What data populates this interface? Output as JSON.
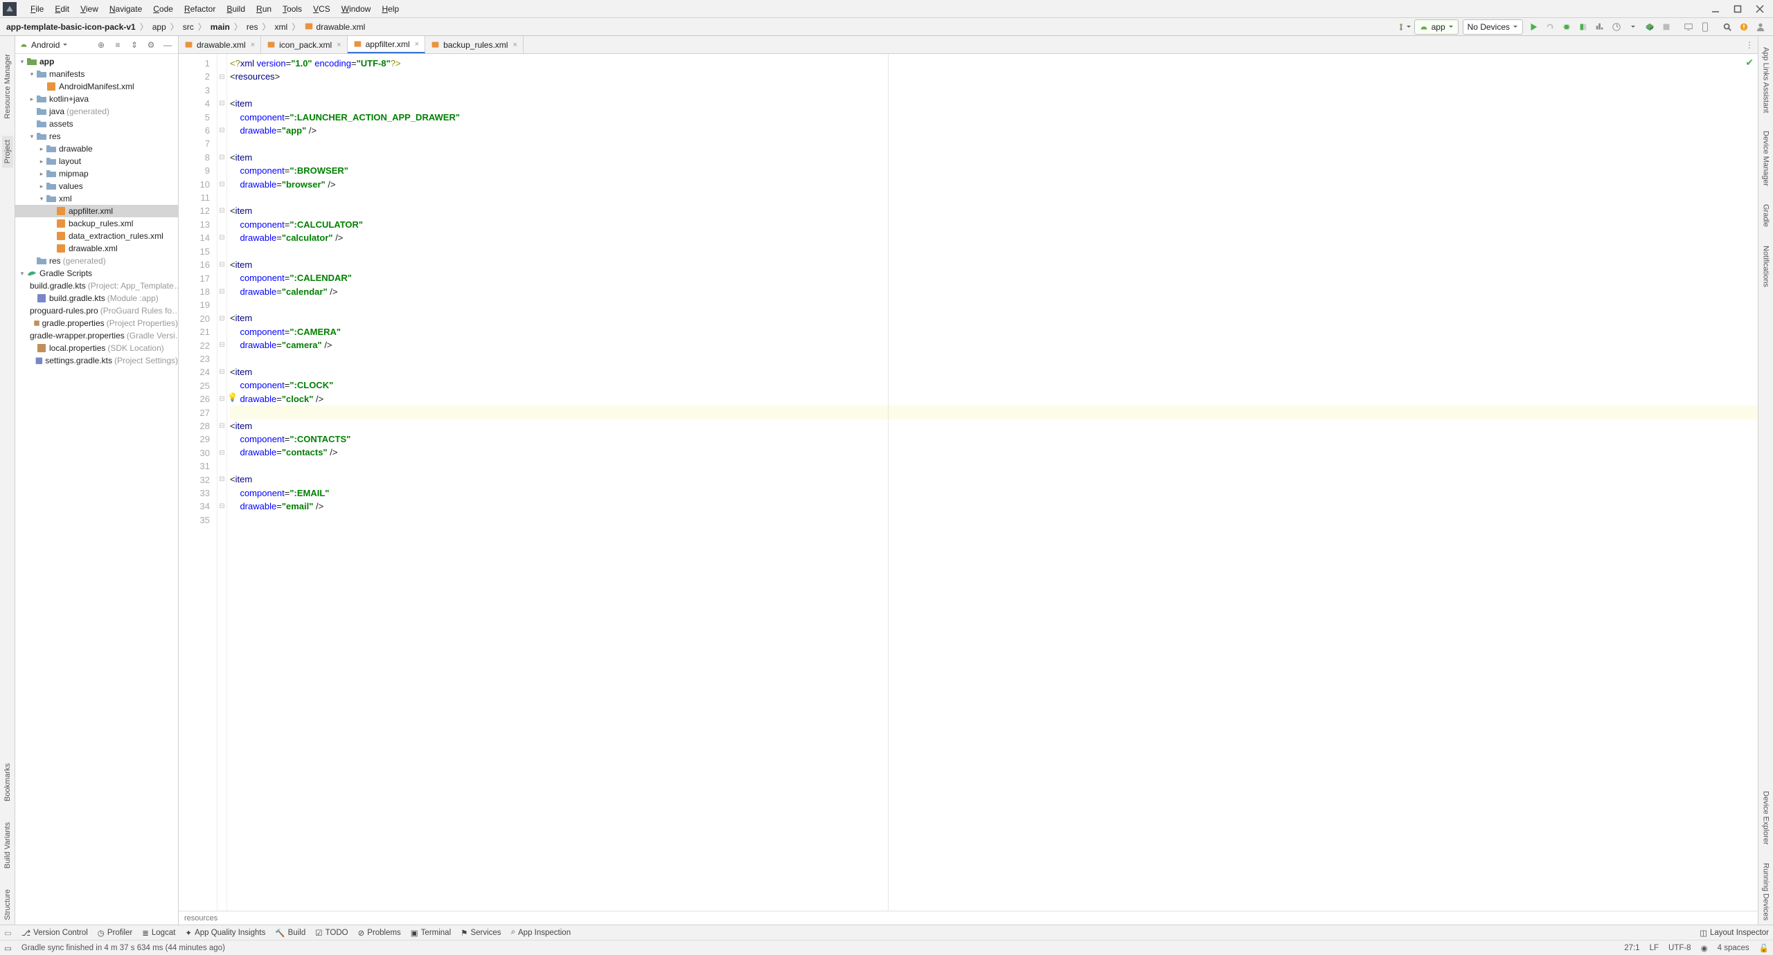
{
  "menu": {
    "items": [
      "File",
      "Edit",
      "View",
      "Navigate",
      "Code",
      "Refactor",
      "Build",
      "Run",
      "Tools",
      "VCS",
      "Window",
      "Help"
    ]
  },
  "breadcrumbs": {
    "items": [
      "app-template-basic-icon-pack-v1",
      "app",
      "src",
      "main",
      "res",
      "xml",
      "drawable.xml"
    ],
    "bold_indices": [
      0,
      3
    ]
  },
  "run_config": {
    "app_label": "app",
    "devices_label": "No Devices"
  },
  "project_header": {
    "mode": "Android"
  },
  "tree": {
    "app": "app",
    "manifests": "manifests",
    "android_manifest": "AndroidManifest.xml",
    "kotlin_java": "kotlin+java",
    "java_gen": "java",
    "java_gen_note": "(generated)",
    "assets": "assets",
    "res": "res",
    "drawable_dir": "drawable",
    "layout_dir": "layout",
    "mipmap_dir": "mipmap",
    "values_dir": "values",
    "xml_dir": "xml",
    "appfilter": "appfilter.xml",
    "backup_rules": "backup_rules.xml",
    "data_extraction": "data_extraction_rules.xml",
    "drawable_file": "drawable.xml",
    "res_gen": "res",
    "res_gen_note": "(generated)",
    "gradle_scripts": "Gradle Scripts",
    "bg1": "build.gradle.kts",
    "bg1_note": "(Project: App_Template…",
    "bg2": "build.gradle.kts",
    "bg2_note": "(Module :app)",
    "proguard": "proguard-rules.pro",
    "proguard_note": "(ProGuard Rules fo…",
    "gprops": "gradle.properties",
    "gprops_note": "(Project Properties)",
    "gwprops": "gradle-wrapper.properties",
    "gwprops_note": "(Gradle Versi…",
    "lprops": "local.properties",
    "lprops_note": "(SDK Location)",
    "sgradle": "settings.gradle.kts",
    "sgradle_note": "(Project Settings)"
  },
  "tabs": [
    {
      "label": "drawable.xml",
      "active": false
    },
    {
      "label": "icon_pack.xml",
      "active": false
    },
    {
      "label": "appfilter.xml",
      "active": true
    },
    {
      "label": "backup_rules.xml",
      "active": false
    }
  ],
  "editor": {
    "breadcrumb": "resources",
    "current_line": 27,
    "lines": [
      {
        "n": 1,
        "t": "decl",
        "text": "<?xml version=\"1.0\" encoding=\"UTF-8\"?>"
      },
      {
        "n": 2,
        "t": "open",
        "tag": "resources"
      },
      {
        "n": 3,
        "t": "blank"
      },
      {
        "n": 4,
        "t": "open",
        "tag": "item"
      },
      {
        "n": 5,
        "t": "attr",
        "attr": "component",
        "val": ":LAUNCHER_ACTION_APP_DRAWER"
      },
      {
        "n": 6,
        "t": "attr_close",
        "attr": "drawable",
        "val": "app"
      },
      {
        "n": 7,
        "t": "blank"
      },
      {
        "n": 8,
        "t": "open",
        "tag": "item"
      },
      {
        "n": 9,
        "t": "attr",
        "attr": "component",
        "val": ":BROWSER"
      },
      {
        "n": 10,
        "t": "attr_close",
        "attr": "drawable",
        "val": "browser"
      },
      {
        "n": 11,
        "t": "blank"
      },
      {
        "n": 12,
        "t": "open",
        "tag": "item"
      },
      {
        "n": 13,
        "t": "attr",
        "attr": "component",
        "val": ":CALCULATOR"
      },
      {
        "n": 14,
        "t": "attr_close",
        "attr": "drawable",
        "val": "calculator"
      },
      {
        "n": 15,
        "t": "blank"
      },
      {
        "n": 16,
        "t": "open",
        "tag": "item"
      },
      {
        "n": 17,
        "t": "attr",
        "attr": "component",
        "val": ":CALENDAR"
      },
      {
        "n": 18,
        "t": "attr_close",
        "attr": "drawable",
        "val": "calendar"
      },
      {
        "n": 19,
        "t": "blank"
      },
      {
        "n": 20,
        "t": "open",
        "tag": "item"
      },
      {
        "n": 21,
        "t": "attr",
        "attr": "component",
        "val": ":CAMERA"
      },
      {
        "n": 22,
        "t": "attr_close",
        "attr": "drawable",
        "val": "camera"
      },
      {
        "n": 23,
        "t": "blank"
      },
      {
        "n": 24,
        "t": "open",
        "tag": "item"
      },
      {
        "n": 25,
        "t": "attr",
        "attr": "component",
        "val": ":CLOCK"
      },
      {
        "n": 26,
        "t": "attr_close",
        "attr": "drawable",
        "val": "clock",
        "bulb": true
      },
      {
        "n": 27,
        "t": "blank",
        "hl": true
      },
      {
        "n": 28,
        "t": "open",
        "tag": "item"
      },
      {
        "n": 29,
        "t": "attr",
        "attr": "component",
        "val": ":CONTACTS"
      },
      {
        "n": 30,
        "t": "attr_close",
        "attr": "drawable",
        "val": "contacts"
      },
      {
        "n": 31,
        "t": "blank"
      },
      {
        "n": 32,
        "t": "open",
        "tag": "item"
      },
      {
        "n": 33,
        "t": "attr",
        "attr": "component",
        "val": ":EMAIL"
      },
      {
        "n": 34,
        "t": "attr_close",
        "attr": "drawable",
        "val": "email"
      },
      {
        "n": 35,
        "t": "blank"
      }
    ]
  },
  "left_sidebar": [
    "Resource Manager",
    "Project",
    "Bookmarks",
    "Build Variants",
    "Structure"
  ],
  "right_sidebar": [
    "App Links Assistant",
    "Device Manager",
    "Gradle",
    "Notifications",
    "Device Explorer",
    "Running Devices"
  ],
  "bottom_tools": [
    "Version Control",
    "Profiler",
    "Logcat",
    "App Quality Insights",
    "Build",
    "TODO",
    "Problems",
    "Terminal",
    "Services",
    "App Inspection"
  ],
  "bottom_right": "Layout Inspector",
  "status": {
    "msg": "Gradle sync finished in 4 m 37 s 634 ms (44 minutes ago)",
    "pos": "27:1",
    "le": "LF",
    "enc": "UTF-8",
    "indent": "4 spaces"
  }
}
